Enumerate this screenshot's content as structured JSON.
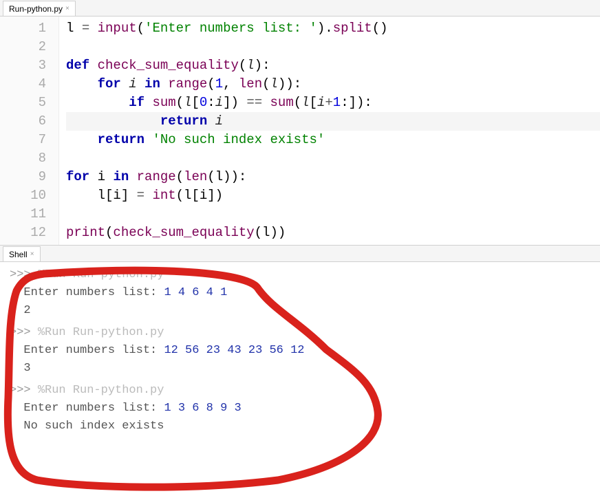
{
  "tabs": {
    "editor_tab": "Run-python.py",
    "shell_tab": "Shell"
  },
  "code": {
    "lines": [
      {
        "n": "1",
        "tokens": [
          {
            "t": "l ",
            "c": ""
          },
          {
            "t": "=",
            "c": "op"
          },
          {
            "t": " ",
            "c": ""
          },
          {
            "t": "input",
            "c": "call"
          },
          {
            "t": "(",
            "c": ""
          },
          {
            "t": "'Enter numbers list: '",
            "c": "str"
          },
          {
            "t": ").",
            "c": ""
          },
          {
            "t": "split",
            "c": "call"
          },
          {
            "t": "()",
            "c": ""
          }
        ]
      },
      {
        "n": "2",
        "tokens": []
      },
      {
        "n": "3",
        "tokens": [
          {
            "t": "def",
            "c": "kw"
          },
          {
            "t": " ",
            "c": ""
          },
          {
            "t": "check_sum_equality",
            "c": "fn"
          },
          {
            "t": "(",
            "c": ""
          },
          {
            "t": "l",
            "c": "id"
          },
          {
            "t": "):",
            "c": ""
          }
        ]
      },
      {
        "n": "4",
        "tokens": [
          {
            "t": "    ",
            "c": ""
          },
          {
            "t": "for",
            "c": "kw"
          },
          {
            "t": " ",
            "c": ""
          },
          {
            "t": "i",
            "c": "id"
          },
          {
            "t": " ",
            "c": ""
          },
          {
            "t": "in",
            "c": "kw"
          },
          {
            "t": " ",
            "c": ""
          },
          {
            "t": "range",
            "c": "call"
          },
          {
            "t": "(",
            "c": ""
          },
          {
            "t": "1",
            "c": "num"
          },
          {
            "t": ", ",
            "c": ""
          },
          {
            "t": "len",
            "c": "call"
          },
          {
            "t": "(",
            "c": ""
          },
          {
            "t": "l",
            "c": "id"
          },
          {
            "t": ")):",
            "c": ""
          }
        ]
      },
      {
        "n": "5",
        "tokens": [
          {
            "t": "        ",
            "c": ""
          },
          {
            "t": "if",
            "c": "kw"
          },
          {
            "t": " ",
            "c": ""
          },
          {
            "t": "sum",
            "c": "call"
          },
          {
            "t": "(",
            "c": ""
          },
          {
            "t": "l",
            "c": "id"
          },
          {
            "t": "[",
            "c": ""
          },
          {
            "t": "0",
            "c": "num"
          },
          {
            "t": ":",
            "c": ""
          },
          {
            "t": "i",
            "c": "id"
          },
          {
            "t": "]) ",
            "c": ""
          },
          {
            "t": "==",
            "c": "op"
          },
          {
            "t": " ",
            "c": ""
          },
          {
            "t": "sum",
            "c": "call"
          },
          {
            "t": "(",
            "c": ""
          },
          {
            "t": "l",
            "c": "id"
          },
          {
            "t": "[",
            "c": ""
          },
          {
            "t": "i",
            "c": "id"
          },
          {
            "t": "+",
            "c": "op"
          },
          {
            "t": "1",
            "c": "num"
          },
          {
            "t": ":]):",
            "c": ""
          }
        ]
      },
      {
        "n": "6",
        "hl": true,
        "tokens": [
          {
            "t": "            ",
            "c": ""
          },
          {
            "t": "return",
            "c": "kw"
          },
          {
            "t": " ",
            "c": ""
          },
          {
            "t": "i",
            "c": "id"
          }
        ]
      },
      {
        "n": "7",
        "tokens": [
          {
            "t": "    ",
            "c": ""
          },
          {
            "t": "return",
            "c": "kw"
          },
          {
            "t": " ",
            "c": ""
          },
          {
            "t": "'No such index exists'",
            "c": "str"
          }
        ]
      },
      {
        "n": "8",
        "tokens": []
      },
      {
        "n": "9",
        "tokens": [
          {
            "t": "for",
            "c": "kw"
          },
          {
            "t": " i ",
            "c": ""
          },
          {
            "t": "in",
            "c": "kw"
          },
          {
            "t": " ",
            "c": ""
          },
          {
            "t": "range",
            "c": "call"
          },
          {
            "t": "(",
            "c": ""
          },
          {
            "t": "len",
            "c": "call"
          },
          {
            "t": "(l)):",
            "c": ""
          }
        ]
      },
      {
        "n": "10",
        "tokens": [
          {
            "t": "    l[i] ",
            "c": ""
          },
          {
            "t": "=",
            "c": "op"
          },
          {
            "t": " ",
            "c": ""
          },
          {
            "t": "int",
            "c": "call"
          },
          {
            "t": "(l[i])",
            "c": ""
          }
        ]
      },
      {
        "n": "11",
        "tokens": []
      },
      {
        "n": "12",
        "tokens": [
          {
            "t": "print",
            "c": "call"
          },
          {
            "t": "(",
            "c": ""
          },
          {
            "t": "check_sum_equality",
            "c": "call"
          },
          {
            "t": "(l))",
            "c": ""
          }
        ]
      }
    ]
  },
  "shell": {
    "runs": [
      {
        "cmd": "%Run Run-python.py",
        "prompt_in": "Enter numbers list: ",
        "input": "1 4 6 4 1",
        "output": "2"
      },
      {
        "cmd": "%Run Run-python.py",
        "prompt_in": "Enter numbers list: ",
        "input": "12 56 23 43 23 56 12",
        "output": "3"
      },
      {
        "cmd": "%Run Run-python.py",
        "prompt_in": "Enter numbers list: ",
        "input": "1 3 6 8 9 3",
        "output": "No such index exists"
      }
    ],
    "prompt": ">>> "
  }
}
